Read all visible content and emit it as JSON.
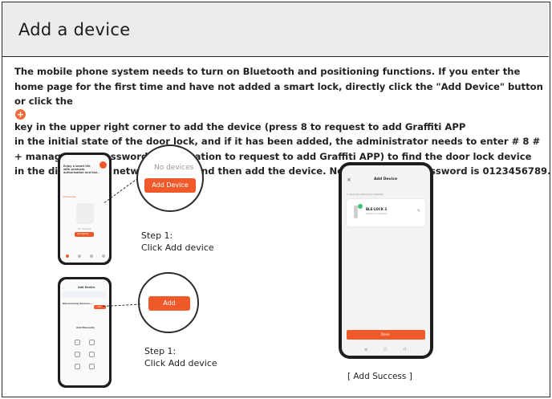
{
  "header": {
    "title": "Add a device"
  },
  "paragraph": {
    "line1": "The mobile phone system needs to turn on Bluetooth and positioning functions. If you enter the",
    "line2": "home page for the first time and have not added a smart lock, directly click the \"Add Device\" button",
    "line3a": "or click the",
    "line3b": "key in the upper right corner to add the device (press 8 to request to add Graffiti APP",
    "line4": "in the initial state of the door lock, and if it has been added, the administrator needs to enter # 8 #",
    "line5": "+ management password authorization to request to add Graffiti APP) to find the door lock device",
    "line6": "in the distribution network mode, and then add the device. Note: The initial password is 0123456789.",
    "plus_icon": "plus-circle-icon"
  },
  "zoom1": {
    "no_devices": "No devices",
    "button": "Add Device"
  },
  "zoom2": {
    "button": "Add"
  },
  "step1": {
    "line1": "Step 1:",
    "line2": "Click Add device"
  },
  "step2": {
    "line1": "Step 1:",
    "line2": "Click Add device"
  },
  "phone1": {
    "heading_l1": "Enjoy a smart life",
    "heading_l2": "with products",
    "heading_l3": "authorization and Use..",
    "tabs": "All Devices",
    "empty": "No devices",
    "button": "Add Device"
  },
  "phone2": {
    "title": "Add Device",
    "scanning": "Discovering devices...",
    "add": "Add",
    "manual": "Add Manually"
  },
  "phone3": {
    "close": "×",
    "title": "Add Device",
    "added_note": "1 device(s) added successfully",
    "device_name": "BLE-LOCK 3",
    "device_status": "Added successfully",
    "done": "Done"
  },
  "success_caption": "[ Add Success ]",
  "colors": {
    "accent": "#f05a2b",
    "title_bg": "#ececec"
  }
}
